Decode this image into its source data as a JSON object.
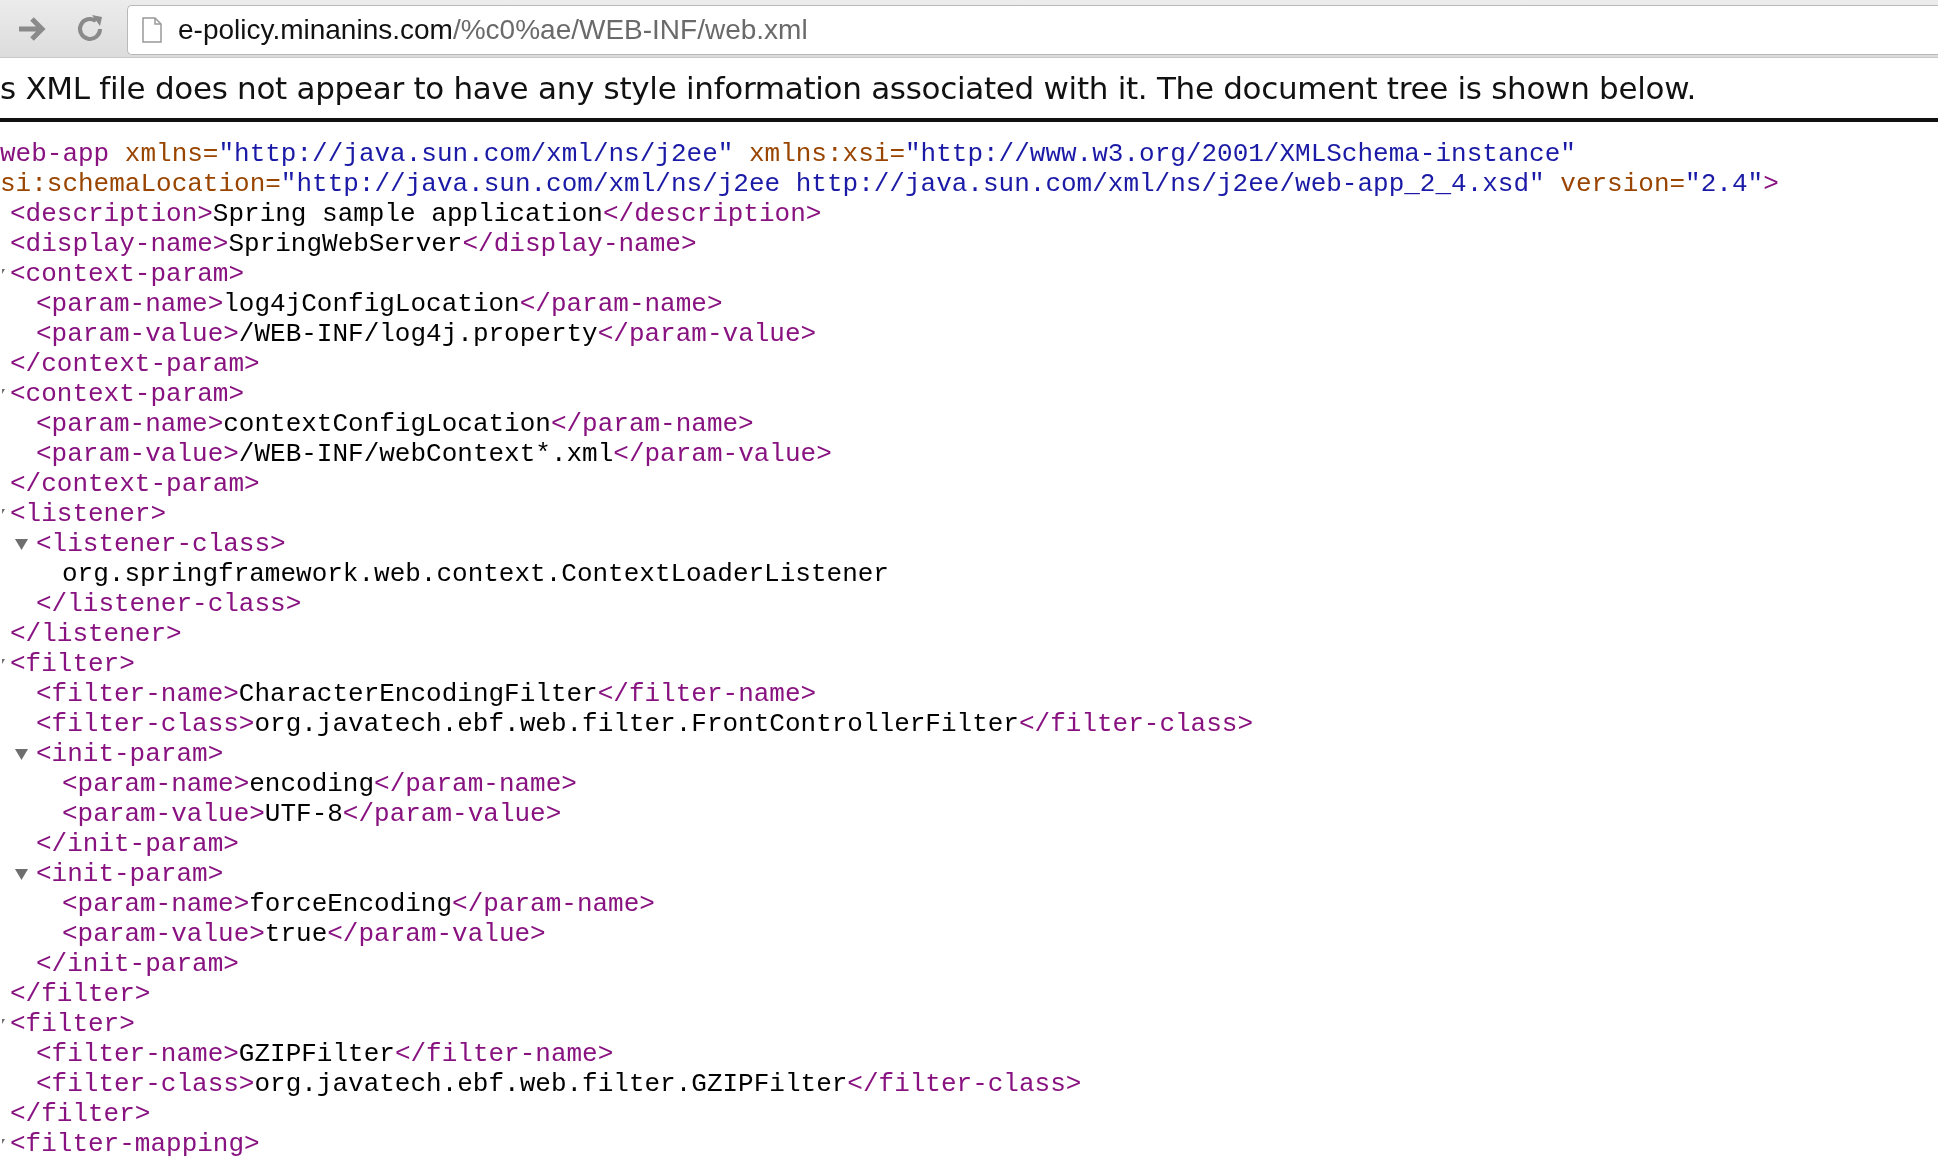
{
  "toolbar": {
    "url": {
      "host": "e-policy.minanins.com",
      "path": "/%c0%ae/WEB-INF/web.xml"
    }
  },
  "notice": "s XML file does not appear to have any style information associated with it. The document tree is shown below.",
  "tree": {
    "kind": "element",
    "open_lines": [
      [
        {
          "kind": "tag",
          "text": "web-app "
        },
        {
          "kind": "attr",
          "text": "xmlns="
        },
        {
          "kind": "value",
          "text": "\"http://java.sun.com/xml/ns/j2ee\" "
        },
        {
          "kind": "attr",
          "text": "xmlns:xsi="
        },
        {
          "kind": "value",
          "text": "\"http://www.w3.org/2001/XMLSchema-instance\""
        }
      ],
      [
        {
          "kind": "attr",
          "text": "si:schemaLocation="
        },
        {
          "kind": "value",
          "text": "\"http://java.sun.com/xml/ns/j2ee http://java.sun.com/xml/ns/j2ee/web-app_2_4.xsd\" "
        },
        {
          "kind": "attr",
          "text": "version="
        },
        {
          "kind": "value",
          "text": "\"2.4\""
        },
        {
          "kind": "tag",
          "text": ">"
        }
      ]
    ],
    "children": [
      {
        "kind": "leaf",
        "open": "<description>",
        "text": "Spring sample application",
        "close": "</description>"
      },
      {
        "kind": "leaf",
        "open": "<display-name>",
        "text": "SpringWebServer",
        "close": "</display-name>"
      },
      {
        "kind": "element",
        "expanded": true,
        "open": "<context-param>",
        "close": "</context-param>",
        "children": [
          {
            "kind": "leaf",
            "open": "<param-name>",
            "text": "log4jConfigLocation",
            "close": "</param-name>"
          },
          {
            "kind": "leaf",
            "open": "<param-value>",
            "text": "/WEB-INF/log4j.property",
            "close": "</param-value>"
          }
        ]
      },
      {
        "kind": "element",
        "expanded": true,
        "open": "<context-param>",
        "close": "</context-param>",
        "children": [
          {
            "kind": "leaf",
            "open": "<param-name>",
            "text": "contextConfigLocation",
            "close": "</param-name>"
          },
          {
            "kind": "leaf",
            "open": "<param-value>",
            "text": "/WEB-INF/webContext*.xml",
            "close": "</param-value>"
          }
        ]
      },
      {
        "kind": "element",
        "expanded": true,
        "open": "<listener>",
        "close": "</listener>",
        "children": [
          {
            "kind": "element",
            "expanded": true,
            "open": "<listener-class>",
            "close": "</listener-class>",
            "children": [
              {
                "kind": "text",
                "text": "org.springframework.web.context.ContextLoaderListener"
              }
            ]
          }
        ]
      },
      {
        "kind": "element",
        "expanded": true,
        "open": "<filter>",
        "close": "</filter>",
        "children": [
          {
            "kind": "leaf",
            "open": "<filter-name>",
            "text": "CharacterEncodingFilter",
            "close": "</filter-name>"
          },
          {
            "kind": "leaf",
            "open": "<filter-class>",
            "text": "org.javatech.ebf.web.filter.FrontControllerFilter",
            "close": "</filter-class>"
          },
          {
            "kind": "element",
            "expanded": true,
            "open": "<init-param>",
            "close": "</init-param>",
            "children": [
              {
                "kind": "leaf",
                "open": "<param-name>",
                "text": "encoding",
                "close": "</param-name>"
              },
              {
                "kind": "leaf",
                "open": "<param-value>",
                "text": "UTF-8",
                "close": "</param-value>"
              }
            ]
          },
          {
            "kind": "element",
            "expanded": true,
            "open": "<init-param>",
            "close": "</init-param>",
            "children": [
              {
                "kind": "leaf",
                "open": "<param-name>",
                "text": "forceEncoding",
                "close": "</param-name>"
              },
              {
                "kind": "leaf",
                "open": "<param-value>",
                "text": "true",
                "close": "</param-value>"
              }
            ]
          }
        ]
      },
      {
        "kind": "element",
        "expanded": true,
        "open": "<filter>",
        "close": "</filter>",
        "children": [
          {
            "kind": "leaf",
            "open": "<filter-name>",
            "text": "GZIPFilter",
            "close": "</filter-name>"
          },
          {
            "kind": "leaf",
            "open": "<filter-class>",
            "text": "org.javatech.ebf.web.filter.GZIPFilter",
            "close": "</filter-class>"
          }
        ]
      },
      {
        "kind": "element",
        "expanded": true,
        "open": "<filter-mapping>"
      }
    ]
  }
}
